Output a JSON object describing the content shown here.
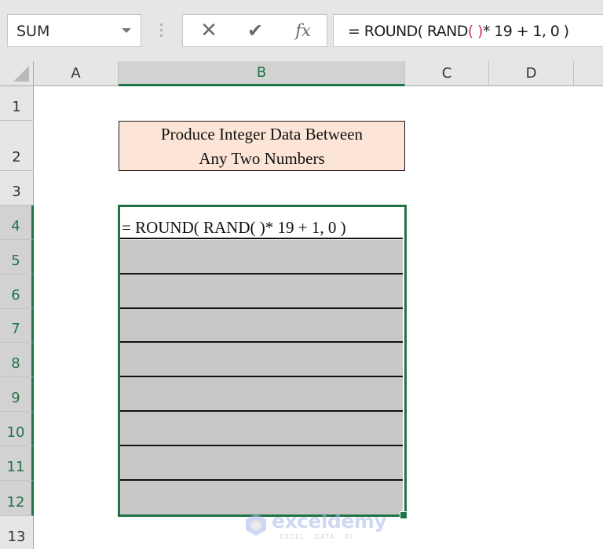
{
  "formula_bar": {
    "name_box": "SUM",
    "cancel_icon": "close-icon",
    "enter_icon": "checkmark-icon",
    "fx_label": "fx",
    "formula_prefix": "= ROUND( RAND",
    "formula_paren": "( )",
    "formula_suffix": "* 19 + 1, 0 )"
  },
  "columns": [
    {
      "label": "A",
      "selected": false
    },
    {
      "label": "B",
      "selected": true
    },
    {
      "label": "C",
      "selected": false
    },
    {
      "label": "D",
      "selected": false
    }
  ],
  "rows": [
    "1",
    "2",
    "3",
    "4",
    "5",
    "6",
    "7",
    "8",
    "9",
    "10",
    "11",
    "12",
    "13"
  ],
  "selected_rows": [
    "4",
    "5",
    "6",
    "7",
    "8",
    "9",
    "10",
    "11",
    "12"
  ],
  "cells": {
    "B2_line1": "Produce Integer Data Between",
    "B2_line2": "Any Two Numbers",
    "B4": "= ROUND( RAND( )* 19 + 1, 0 )"
  },
  "colors": {
    "selection": "#217346",
    "title_fill": "#fce4d6",
    "empty_fill": "#c8c8c8"
  },
  "watermark": {
    "brand": "exceldemy",
    "tagline": "EXCEL · DATA · BI"
  }
}
